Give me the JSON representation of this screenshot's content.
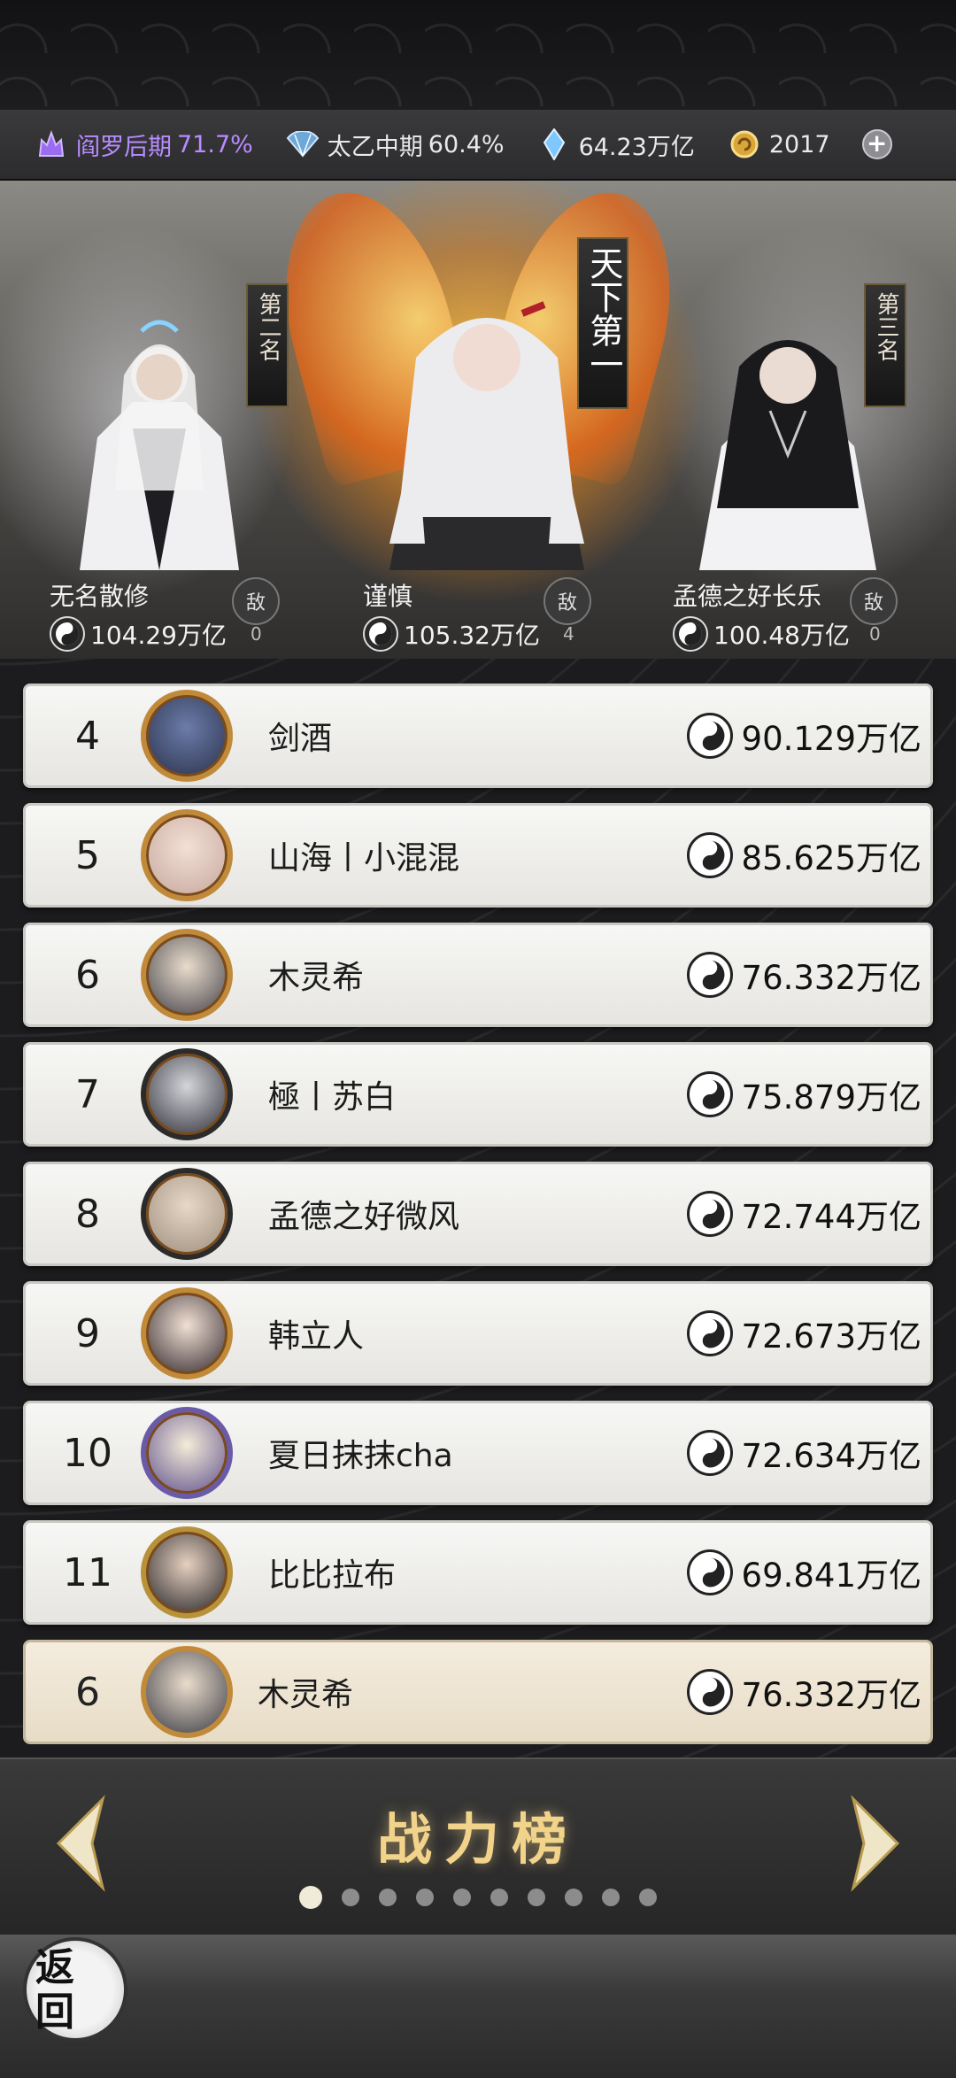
{
  "status_bar": {
    "realm1": {
      "name": "阎罗后期",
      "pct": "71.7%"
    },
    "realm2": {
      "name": "太乙中期",
      "pct": "60.4%"
    },
    "spirit_stones": "64.23万亿",
    "currency": "2017"
  },
  "top3": {
    "first": {
      "banner": "天下第一",
      "name": "谨慎",
      "power": "105.32万亿",
      "badge": "敌",
      "count": "4"
    },
    "second": {
      "banner": "第二名",
      "name": "无名散修",
      "power": "104.29万亿",
      "badge": "敌",
      "count": "0"
    },
    "third": {
      "banner": "第三名",
      "name": "孟德之好长乐",
      "power": "100.48万亿",
      "badge": "敌",
      "count": "0"
    }
  },
  "ranking": [
    {
      "rank": "4",
      "name": "剑酒",
      "power": "90.129万亿"
    },
    {
      "rank": "5",
      "name": "山海丨小混混",
      "power": "85.625万亿"
    },
    {
      "rank": "6",
      "name": "木灵希",
      "power": "76.332万亿"
    },
    {
      "rank": "7",
      "name": "極丨苏白",
      "power": "75.879万亿"
    },
    {
      "rank": "8",
      "name": "孟德之好微风",
      "power": "72.744万亿"
    },
    {
      "rank": "9",
      "name": "韩立人",
      "power": "72.673万亿"
    },
    {
      "rank": "10",
      "name": "夏日抹抹cha",
      "power": "72.634万亿"
    },
    {
      "rank": "11",
      "name": "比比拉布",
      "power": "69.841万亿"
    }
  ],
  "self_row": {
    "rank": "6",
    "name": "木灵希",
    "power": "76.332万亿"
  },
  "board": {
    "title": "战力榜",
    "page_count": 10,
    "active_page": 1
  },
  "back_button": {
    "label": "返回"
  },
  "colors": {
    "accent_gold": "#f1d38a",
    "realm_purple": "#b88cff"
  }
}
